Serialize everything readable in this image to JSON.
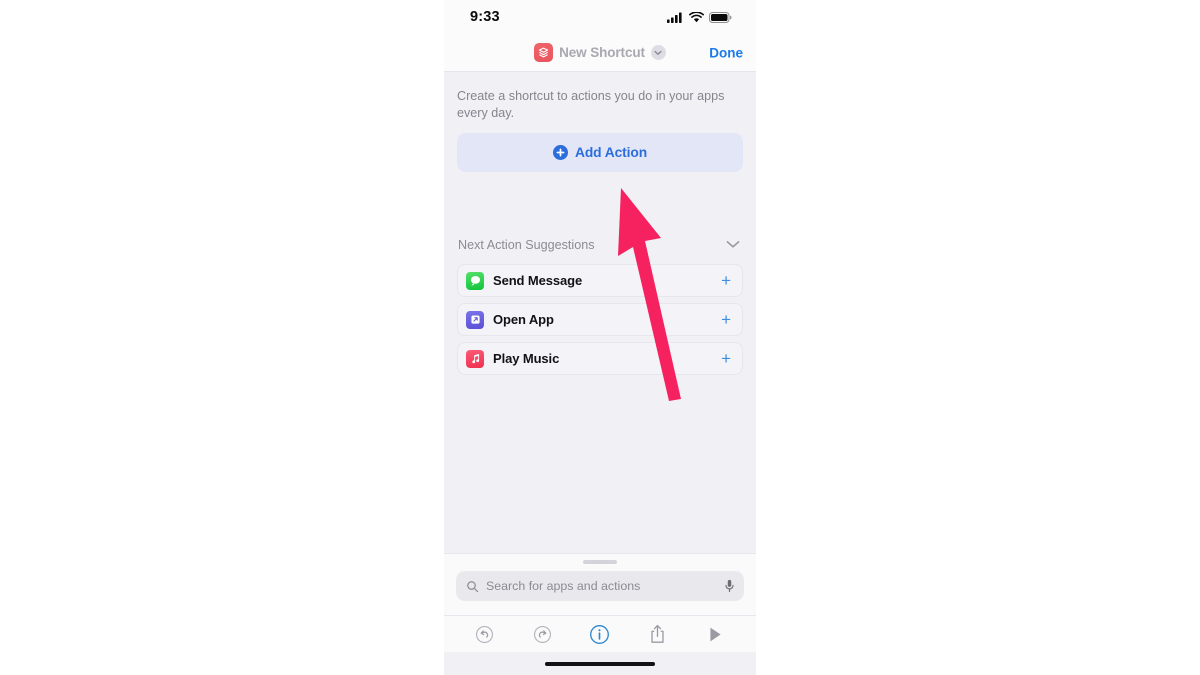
{
  "status_bar": {
    "time": "9:33",
    "icons": [
      "cellular-signal-icon",
      "wifi-icon",
      "battery-icon"
    ]
  },
  "nav_bar": {
    "app_icon": "shortcuts-app-icon",
    "title": "New Shortcut",
    "disclosure_icon": "chevron-down-icon",
    "done_label": "Done"
  },
  "main": {
    "intro_text": "Create a shortcut to actions you do in your apps every day.",
    "add_action": {
      "label": "Add Action",
      "icon": "plus-circle-icon",
      "accent_color": "#2b6ddb",
      "background_color": "#e2e6f6"
    },
    "suggestions": {
      "title": "Next Action Suggestions",
      "collapse_icon": "chevron-down-icon",
      "rows": [
        {
          "label": "Send Message",
          "icon": "messages-app-icon",
          "icon_color": "#10c43b",
          "add_icon": "plus-icon"
        },
        {
          "label": "Open App",
          "icon": "open-app-icon",
          "icon_color": "#5b4fd6",
          "add_icon": "plus-icon"
        },
        {
          "label": "Play Music",
          "icon": "music-app-icon",
          "icon_color": "#f0304f",
          "add_icon": "plus-icon"
        }
      ]
    }
  },
  "search": {
    "placeholder": "Search for apps and actions",
    "search_icon": "search-icon",
    "mic_icon": "microphone-icon"
  },
  "toolbar": {
    "items": [
      {
        "name": "undo-button",
        "icon": "undo-icon",
        "active": false
      },
      {
        "name": "redo-button",
        "icon": "redo-icon",
        "active": false
      },
      {
        "name": "info-button",
        "icon": "info-circle-icon",
        "active": true
      },
      {
        "name": "share-button",
        "icon": "share-icon",
        "active": false
      },
      {
        "name": "play-button",
        "icon": "play-icon",
        "active": false
      }
    ],
    "active_color": "#2b88cf",
    "inactive_color": "#9b9aa3"
  },
  "annotation": {
    "type": "arrow",
    "color": "#f5225f",
    "points_to": "Add Action"
  }
}
